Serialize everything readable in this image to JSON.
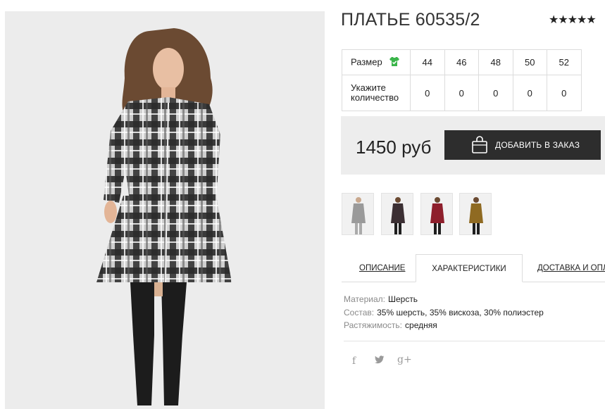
{
  "product": {
    "title": "ПЛАТЬЕ 60535/2",
    "rating_stars": "★★★★★",
    "rating": 5
  },
  "size_table": {
    "size_label": "Размер",
    "qty_label": "Укажите количество",
    "sizes": [
      "44",
      "46",
      "48",
      "50",
      "52"
    ],
    "quantities": [
      "0",
      "0",
      "0",
      "0",
      "0"
    ]
  },
  "purchase": {
    "price": "1450 руб",
    "add_button_label": "ДОБАВИТЬ В ЗАКАЗ"
  },
  "thumbnails": [
    {
      "color_name": "grey-plaid",
      "bg": "#f1f1f1",
      "dress": "#9a9a9a"
    },
    {
      "color_name": "dark-plaid",
      "bg": "#f1f1f1",
      "dress": "#3b2f33"
    },
    {
      "color_name": "red-plaid",
      "bg": "#f1f1f1",
      "dress": "#8e1f2c"
    },
    {
      "color_name": "mustard-plaid",
      "bg": "#f1f1f1",
      "dress": "#8f6a22"
    }
  ],
  "tabs": [
    {
      "label": "ОПИСАНИЕ",
      "active": false
    },
    {
      "label": "ХАРАКТЕРИСТИКИ",
      "active": true
    },
    {
      "label": "ДОСТАВКА И ОПЛА",
      "active": false
    }
  ],
  "specs": [
    {
      "key": "Материал:",
      "value": "Шерсть"
    },
    {
      "key": "Состав:",
      "value": "35% шерсть, 35% вискоза, 30% полиэстер"
    },
    {
      "key": "Растяжимость:",
      "value": "средняя"
    }
  ],
  "social": {
    "facebook": "f",
    "twitter": "t",
    "googleplus": "g+"
  },
  "colors": {
    "button_bg": "#2d2d2d",
    "price_box_bg": "#ededed",
    "size_icon": "#3ab54a",
    "photo_bg": "#ececec"
  },
  "icons": {
    "size_guide": "shirt-check-icon",
    "add_to_cart": "shopping-bag-icon"
  }
}
